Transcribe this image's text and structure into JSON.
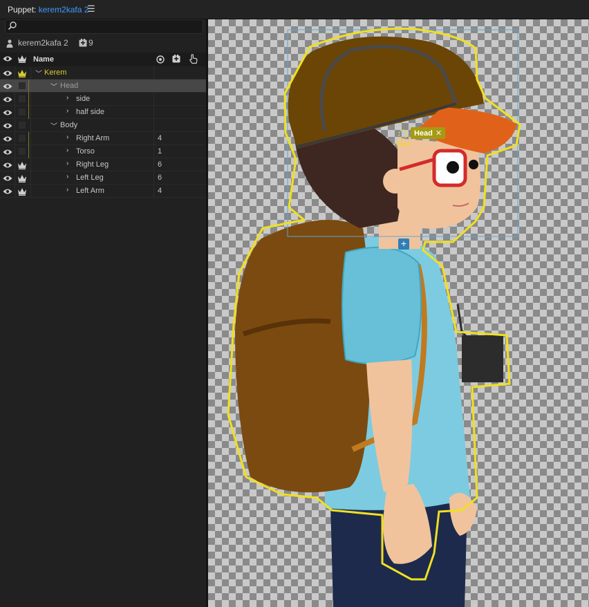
{
  "window": {
    "panel_label": "Puppet:",
    "puppet_name": "kerem2kafa 2",
    "menu_icon": "hamburger-menu-icon"
  },
  "search": {
    "placeholder": "",
    "icon": "search-icon"
  },
  "puppet": {
    "name": "kerem2kafa 2",
    "count": "9"
  },
  "columns": {
    "name": "Name"
  },
  "rows": [
    {
      "label": "Kerem",
      "count": "",
      "crown": true
    },
    {
      "label": "Head",
      "count": "",
      "crown": false
    },
    {
      "label": "side",
      "count": "",
      "crown": false
    },
    {
      "label": "half side",
      "count": "",
      "crown": false
    },
    {
      "label": "Body",
      "count": "",
      "crown": false
    },
    {
      "label": "Right Arm",
      "count": "4",
      "crown": false
    },
    {
      "label": "Torso",
      "count": "1",
      "crown": false
    },
    {
      "label": "Right Leg",
      "count": "6",
      "crown": true
    },
    {
      "label": "Left Leg",
      "count": "6",
      "crown": true
    },
    {
      "label": "Left Arm",
      "count": "4",
      "crown": true
    }
  ],
  "canvas": {
    "head_tag": "Head",
    "head_tag_close": "✕",
    "handle_label": "Head",
    "add_button": "+"
  },
  "colors": {
    "accent": "#3d9bff",
    "outline": "#f0e020",
    "gold": "#d8cc32"
  }
}
